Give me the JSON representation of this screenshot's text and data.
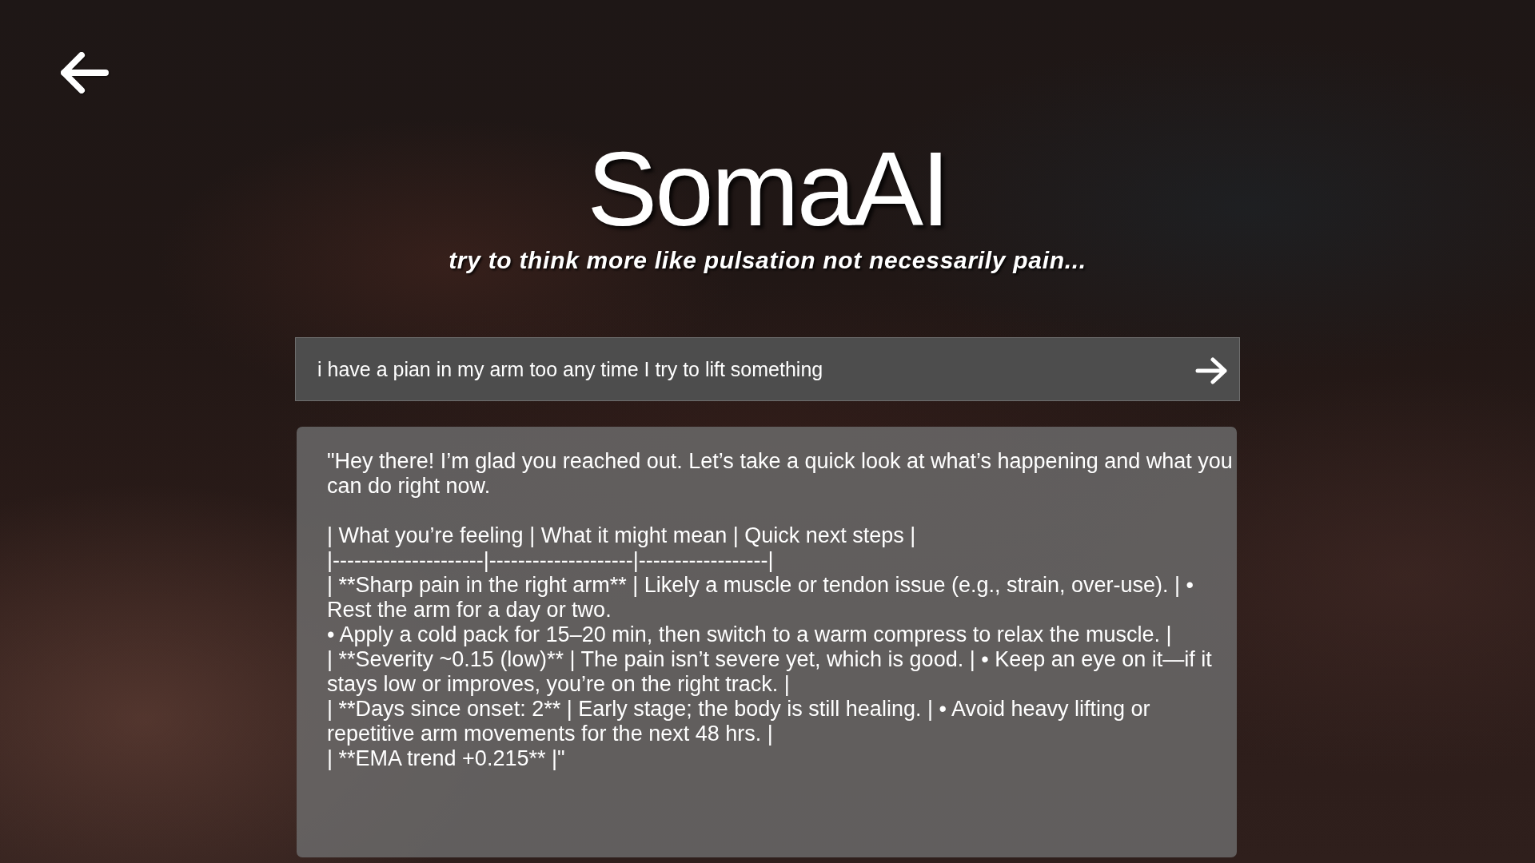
{
  "header": {
    "title": "SomaAI",
    "tagline": "try to think more like pulsation not necessarily pain..."
  },
  "message_input": {
    "value": "i have a pian in my arm too any time I try to lift something"
  },
  "response": {
    "text": "\"Hey there! I’m glad you reached out. Let’s take a quick look at what’s happening and what you can do right now.\n\n| What you’re feeling | What it might mean | Quick next steps |\n|---------------------|--------------------|------------------|\n| **Sharp pain in the right arm** | Likely a muscle or tendon issue (e.g., strain, over-use). | • Rest the arm for a day or two.\n• Apply a cold pack for 15–20 min, then switch to a warm compress to relax the muscle. |\n| **Severity ~0.15 (low)** | The pain isn’t severe yet, which is good. | • Keep an eye on it—if it stays low or improves, you’re on the right track. |\n| **Days since onset: 2** | Early stage; the body is still healing. | • Avoid heavy lifting or repetitive arm movements for the next 48 hrs. |\n| **EMA trend +0.215** |\""
  }
}
